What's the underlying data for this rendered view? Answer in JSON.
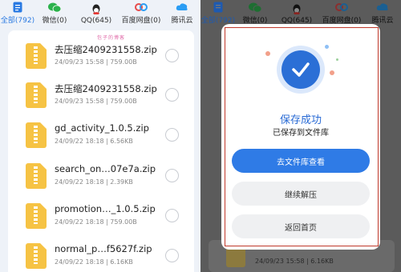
{
  "left": {
    "tabs": [
      {
        "label": "全部(792)",
        "icon": "document-icon",
        "active": true
      },
      {
        "label": "微信(0)",
        "icon": "wechat-icon"
      },
      {
        "label": "QQ(645)",
        "icon": "qq-icon"
      },
      {
        "label": "百度网盘(0)",
        "icon": "baidu-netdisk-icon"
      },
      {
        "label": "腾讯云",
        "icon": "tencent-cloud-icon"
      }
    ],
    "watermark": "包子的博客",
    "files": [
      {
        "name": "去压缩2409231558.zip",
        "meta": "24/09/23 15:58 | 759.00B"
      },
      {
        "name": "去压缩2409231558.zip",
        "meta": "24/09/23 15:58 | 759.00B"
      },
      {
        "name": "gd_activity_1.0.5.zip",
        "meta": "24/09/22 18:18 | 6.56KB"
      },
      {
        "name": "search_on…07e7a.zip",
        "meta": "24/09/22 18:18 | 2.39KB"
      },
      {
        "name": "promotion…_1.0.5.zip",
        "meta": "24/09/22 18:18 | 759.00B"
      },
      {
        "name": "normal_p…f5627f.zip",
        "meta": "24/09/22 18:18 | 6.16KB"
      }
    ]
  },
  "right": {
    "tabs": [
      {
        "label": "全部(792)",
        "active": true
      },
      {
        "label": "微信(0)"
      },
      {
        "label": "QQ(645)"
      },
      {
        "label": "百度网盘(0)"
      },
      {
        "label": "腾讯云"
      }
    ],
    "behind_meta": "24/09/23 15:58 | 6.16KB",
    "dialog": {
      "title": "保存成功",
      "subtitle": "已保存到文件库",
      "primary_button": "去文件库查看",
      "continue_button": "继续解压",
      "home_button": "返回首页",
      "icon": "check-icon"
    }
  },
  "colors": {
    "accent": "#2f7be6",
    "highlight_border": "#c0392b",
    "file_icon": "#f6c344"
  }
}
